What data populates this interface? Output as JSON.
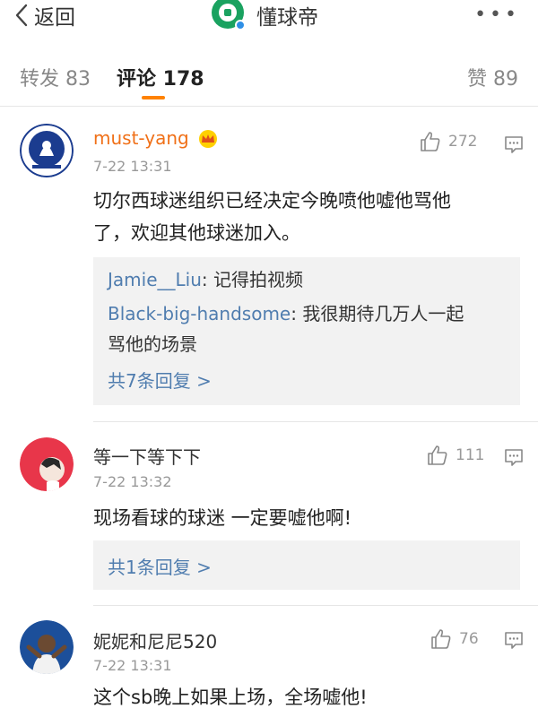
{
  "header": {
    "back_label": "返回",
    "title": "懂球帝",
    "more": "•••"
  },
  "tabs": [
    {
      "label": "转发 83"
    },
    {
      "label": "评论 178"
    },
    {
      "label": "赞 89"
    }
  ],
  "comments": [
    {
      "user": "must-yang",
      "time": "7-22 13:31",
      "likes": "272",
      "text_line1": "切尔西球迷组织已经决定今晚喷他嘘他骂他",
      "text_line2": "了，欢迎其他球迷加入。",
      "replies": [
        {
          "user": "Jamie__Liu",
          "sep": ": ",
          "text": "记得拍视频"
        },
        {
          "user": "Black-big-handsome",
          "sep": ": ",
          "text": "我很期待几万人一起",
          "text2": "骂他的场景"
        }
      ],
      "more_replies": "共7条回复 >"
    },
    {
      "user": "等一下等下下",
      "time": "7-22 13:32",
      "likes": "111",
      "text_line1": "现场看球的球迷 一定要嘘他啊!",
      "more_replies": "共1条回复 >"
    },
    {
      "user": "妮妮和尼尼520",
      "time": "7-22 13:31",
      "likes": "76",
      "text_line1": "这个sb晚上如果上场，全场嘘他!"
    }
  ],
  "colors": {
    "accent": "#ff8200",
    "link": "#507daf",
    "username_highlight": "#f07018",
    "logo_green": "#1aa260"
  }
}
